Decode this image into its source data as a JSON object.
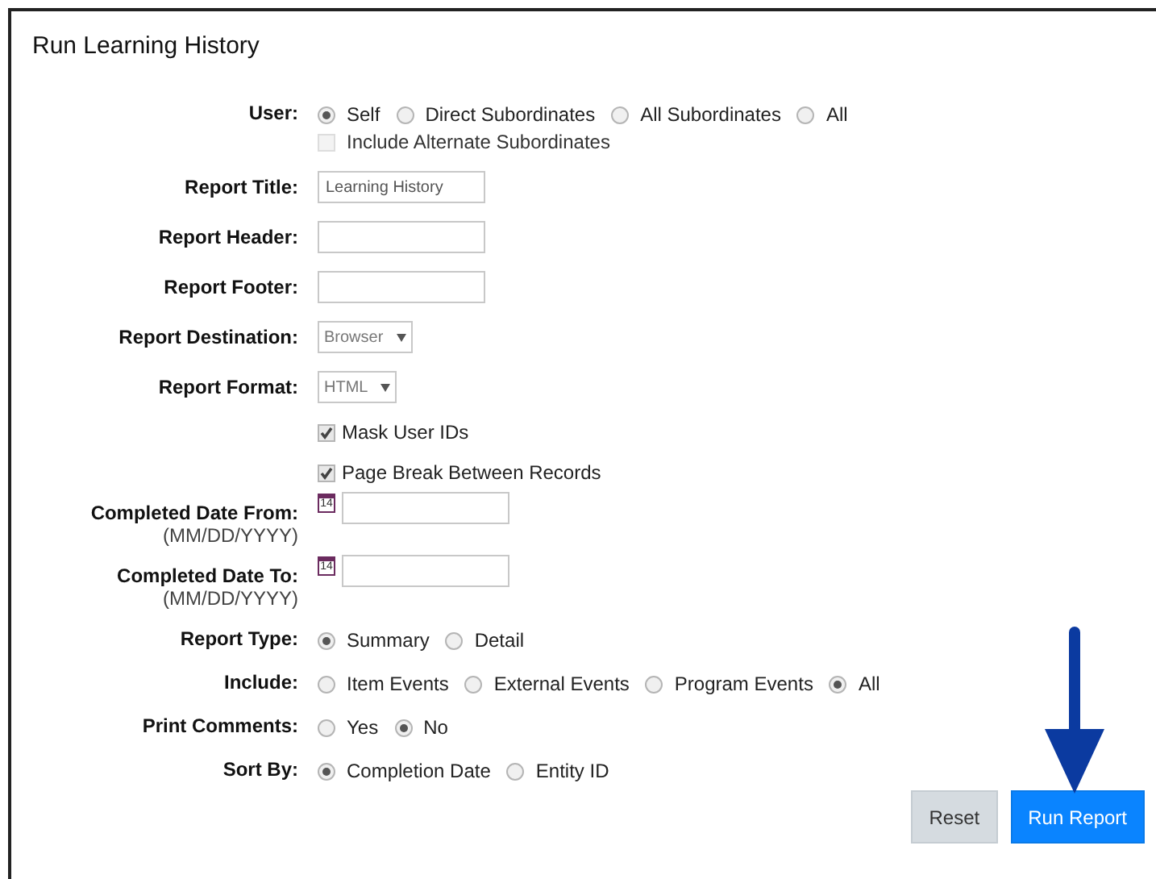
{
  "title": "Run Learning History",
  "rows": [
    {
      "kind": "radio",
      "label": "User:",
      "options": [
        {
          "label": "Self",
          "selected": true
        },
        {
          "label": "Direct Subordinates",
          "selected": false
        },
        {
          "label": "All Subordinates",
          "selected": false
        },
        {
          "label": "All",
          "selected": false
        }
      ],
      "extra": {
        "label": "Include Alternate Subordinates",
        "checked": false,
        "disabled": true
      }
    },
    {
      "kind": "text",
      "label": "Report Title:",
      "value": "Learning History"
    },
    {
      "kind": "text",
      "label": "Report Header:"
    },
    {
      "kind": "text",
      "label": "Report Footer:"
    },
    {
      "kind": "select",
      "label": "Report Destination:",
      "value": "Browser"
    },
    {
      "kind": "select",
      "label": "Report Format:",
      "value": "HTML"
    },
    {
      "kind": "checkbox",
      "label": "Mask User IDs",
      "checked": true
    },
    {
      "kind": "checkbox",
      "label": "Page Break Between Records",
      "checked": true
    },
    {
      "kind": "date",
      "label": "Completed Date From:",
      "sublabel": "(MM/DD/YYYY)",
      "icon_text": "14"
    },
    {
      "kind": "date",
      "label": "Completed Date To:",
      "sublabel": "(MM/DD/YYYY)",
      "icon_text": "14"
    },
    {
      "kind": "radio",
      "label": "Report Type:",
      "options": [
        {
          "label": "Summary",
          "selected": true
        },
        {
          "label": "Detail",
          "selected": false
        }
      ]
    },
    {
      "kind": "radio",
      "label": "Include:",
      "options": [
        {
          "label": "Item Events",
          "selected": false
        },
        {
          "label": "External Events",
          "selected": false
        },
        {
          "label": "Program Events",
          "selected": false
        },
        {
          "label": "All",
          "selected": true
        }
      ]
    },
    {
      "kind": "radio",
      "label": "Print Comments:",
      "options": [
        {
          "label": "Yes",
          "selected": false
        },
        {
          "label": "No",
          "selected": true
        }
      ]
    },
    {
      "kind": "radio",
      "label": "Sort By:",
      "options": [
        {
          "label": "Completion Date",
          "selected": true
        },
        {
          "label": "Entity ID",
          "selected": false
        }
      ]
    }
  ],
  "buttons": [
    {
      "label": "Reset",
      "kind": "secondary"
    },
    {
      "label": "Run Report",
      "kind": "primary"
    }
  ]
}
